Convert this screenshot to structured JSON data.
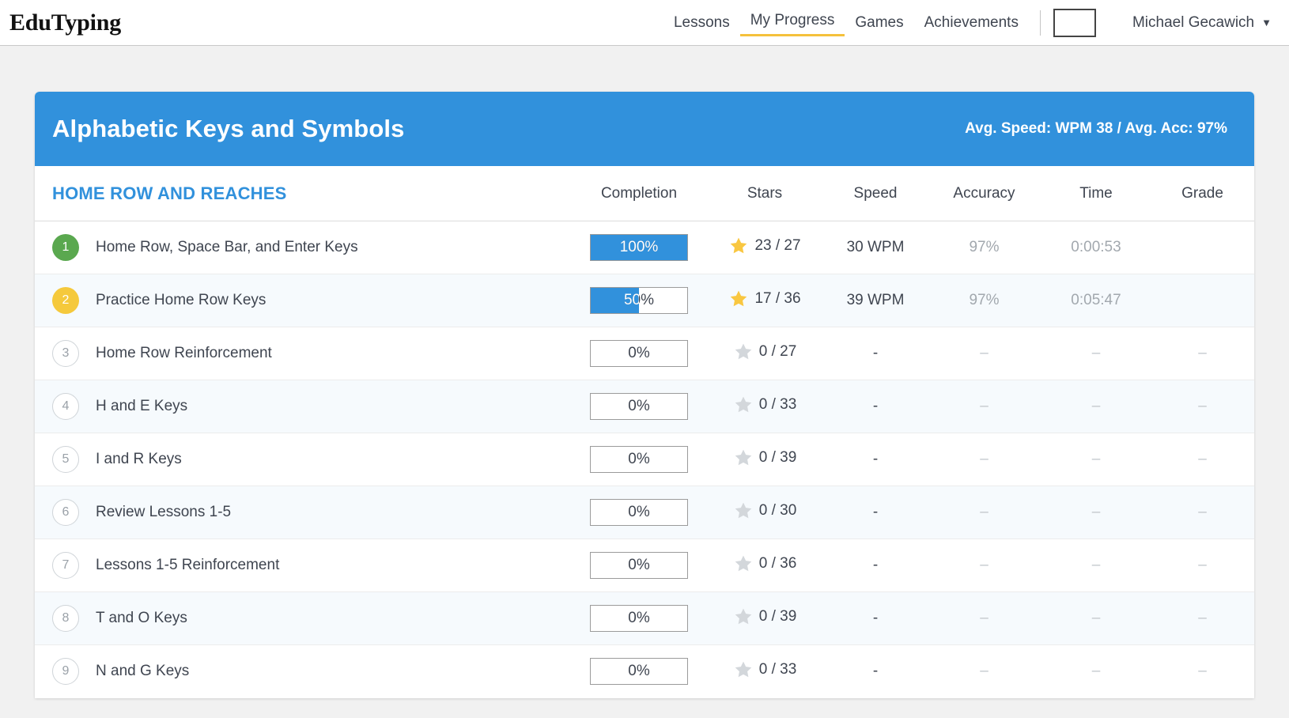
{
  "brand": "EduTyping",
  "nav": {
    "items": [
      {
        "label": "Lessons",
        "active": false
      },
      {
        "label": "My Progress",
        "active": true
      },
      {
        "label": "Games",
        "active": false
      },
      {
        "label": "Achievements",
        "active": false
      }
    ],
    "user_name": "Michael Gecawich",
    "caret": "▼"
  },
  "card": {
    "title": "Alphabetic Keys and Symbols",
    "stats": "Avg. Speed: WPM 38 / Avg. Acc: 97%"
  },
  "table": {
    "section_label": "HOME ROW AND REACHES",
    "headers": {
      "completion": "Completion",
      "stars": "Stars",
      "speed": "Speed",
      "accuracy": "Accuracy",
      "time": "Time",
      "grade": "Grade"
    },
    "rows": [
      {
        "num": "1",
        "badge": "done",
        "name": "Home Row, Space Bar, and Enter Keys",
        "completion_label": "100%",
        "completion_pct": 100,
        "star_state": "filled",
        "stars": "23 / 27",
        "speed": "30 WPM",
        "accuracy": "97%",
        "time": "0:00:53",
        "grade": ""
      },
      {
        "num": "2",
        "badge": "partial",
        "name": "Practice Home Row Keys",
        "completion_label": "50%",
        "completion_pct": 50,
        "star_state": "filled",
        "stars": "17 / 36",
        "speed": "39 WPM",
        "accuracy": "97%",
        "time": "0:05:47",
        "grade": ""
      },
      {
        "num": "3",
        "badge": "todo",
        "name": "Home Row Reinforcement",
        "completion_label": "0%",
        "completion_pct": 0,
        "star_state": "empty",
        "stars": "0 / 27",
        "speed": "-",
        "accuracy": "–",
        "time": "–",
        "grade": "–"
      },
      {
        "num": "4",
        "badge": "todo",
        "name": "H and E Keys",
        "completion_label": "0%",
        "completion_pct": 0,
        "star_state": "empty",
        "stars": "0 / 33",
        "speed": "-",
        "accuracy": "–",
        "time": "–",
        "grade": "–"
      },
      {
        "num": "5",
        "badge": "todo",
        "name": "I and R Keys",
        "completion_label": "0%",
        "completion_pct": 0,
        "star_state": "empty",
        "stars": "0 / 39",
        "speed": "-",
        "accuracy": "–",
        "time": "–",
        "grade": "–"
      },
      {
        "num": "6",
        "badge": "todo",
        "name": "Review Lessons 1-5",
        "completion_label": "0%",
        "completion_pct": 0,
        "star_state": "empty",
        "stars": "0 / 30",
        "speed": "-",
        "accuracy": "–",
        "time": "–",
        "grade": "–"
      },
      {
        "num": "7",
        "badge": "todo",
        "name": "Lessons 1-5 Reinforcement",
        "completion_label": "0%",
        "completion_pct": 0,
        "star_state": "empty",
        "stars": "0 / 36",
        "speed": "-",
        "accuracy": "–",
        "time": "–",
        "grade": "–"
      },
      {
        "num": "8",
        "badge": "todo",
        "name": "T and O Keys",
        "completion_label": "0%",
        "completion_pct": 0,
        "star_state": "empty",
        "stars": "0 / 39",
        "speed": "-",
        "accuracy": "–",
        "time": "–",
        "grade": "–"
      },
      {
        "num": "9",
        "badge": "todo",
        "name": "N and G Keys",
        "completion_label": "0%",
        "completion_pct": 0,
        "star_state": "empty",
        "stars": "0 / 33",
        "speed": "-",
        "accuracy": "–",
        "time": "–",
        "grade": "–"
      }
    ]
  },
  "colors": {
    "brand_blue": "#3191dc",
    "accent_yellow": "#f5c13c",
    "star_gold": "#f9c741",
    "star_gray": "#d3d7db",
    "badge_done_green": "#5aa84f",
    "badge_partial_yellow": "#f5c93c"
  },
  "icons": {
    "star": "star-icon",
    "caret_down": "chevron-down-icon",
    "avatar": "avatar-placeholder"
  }
}
